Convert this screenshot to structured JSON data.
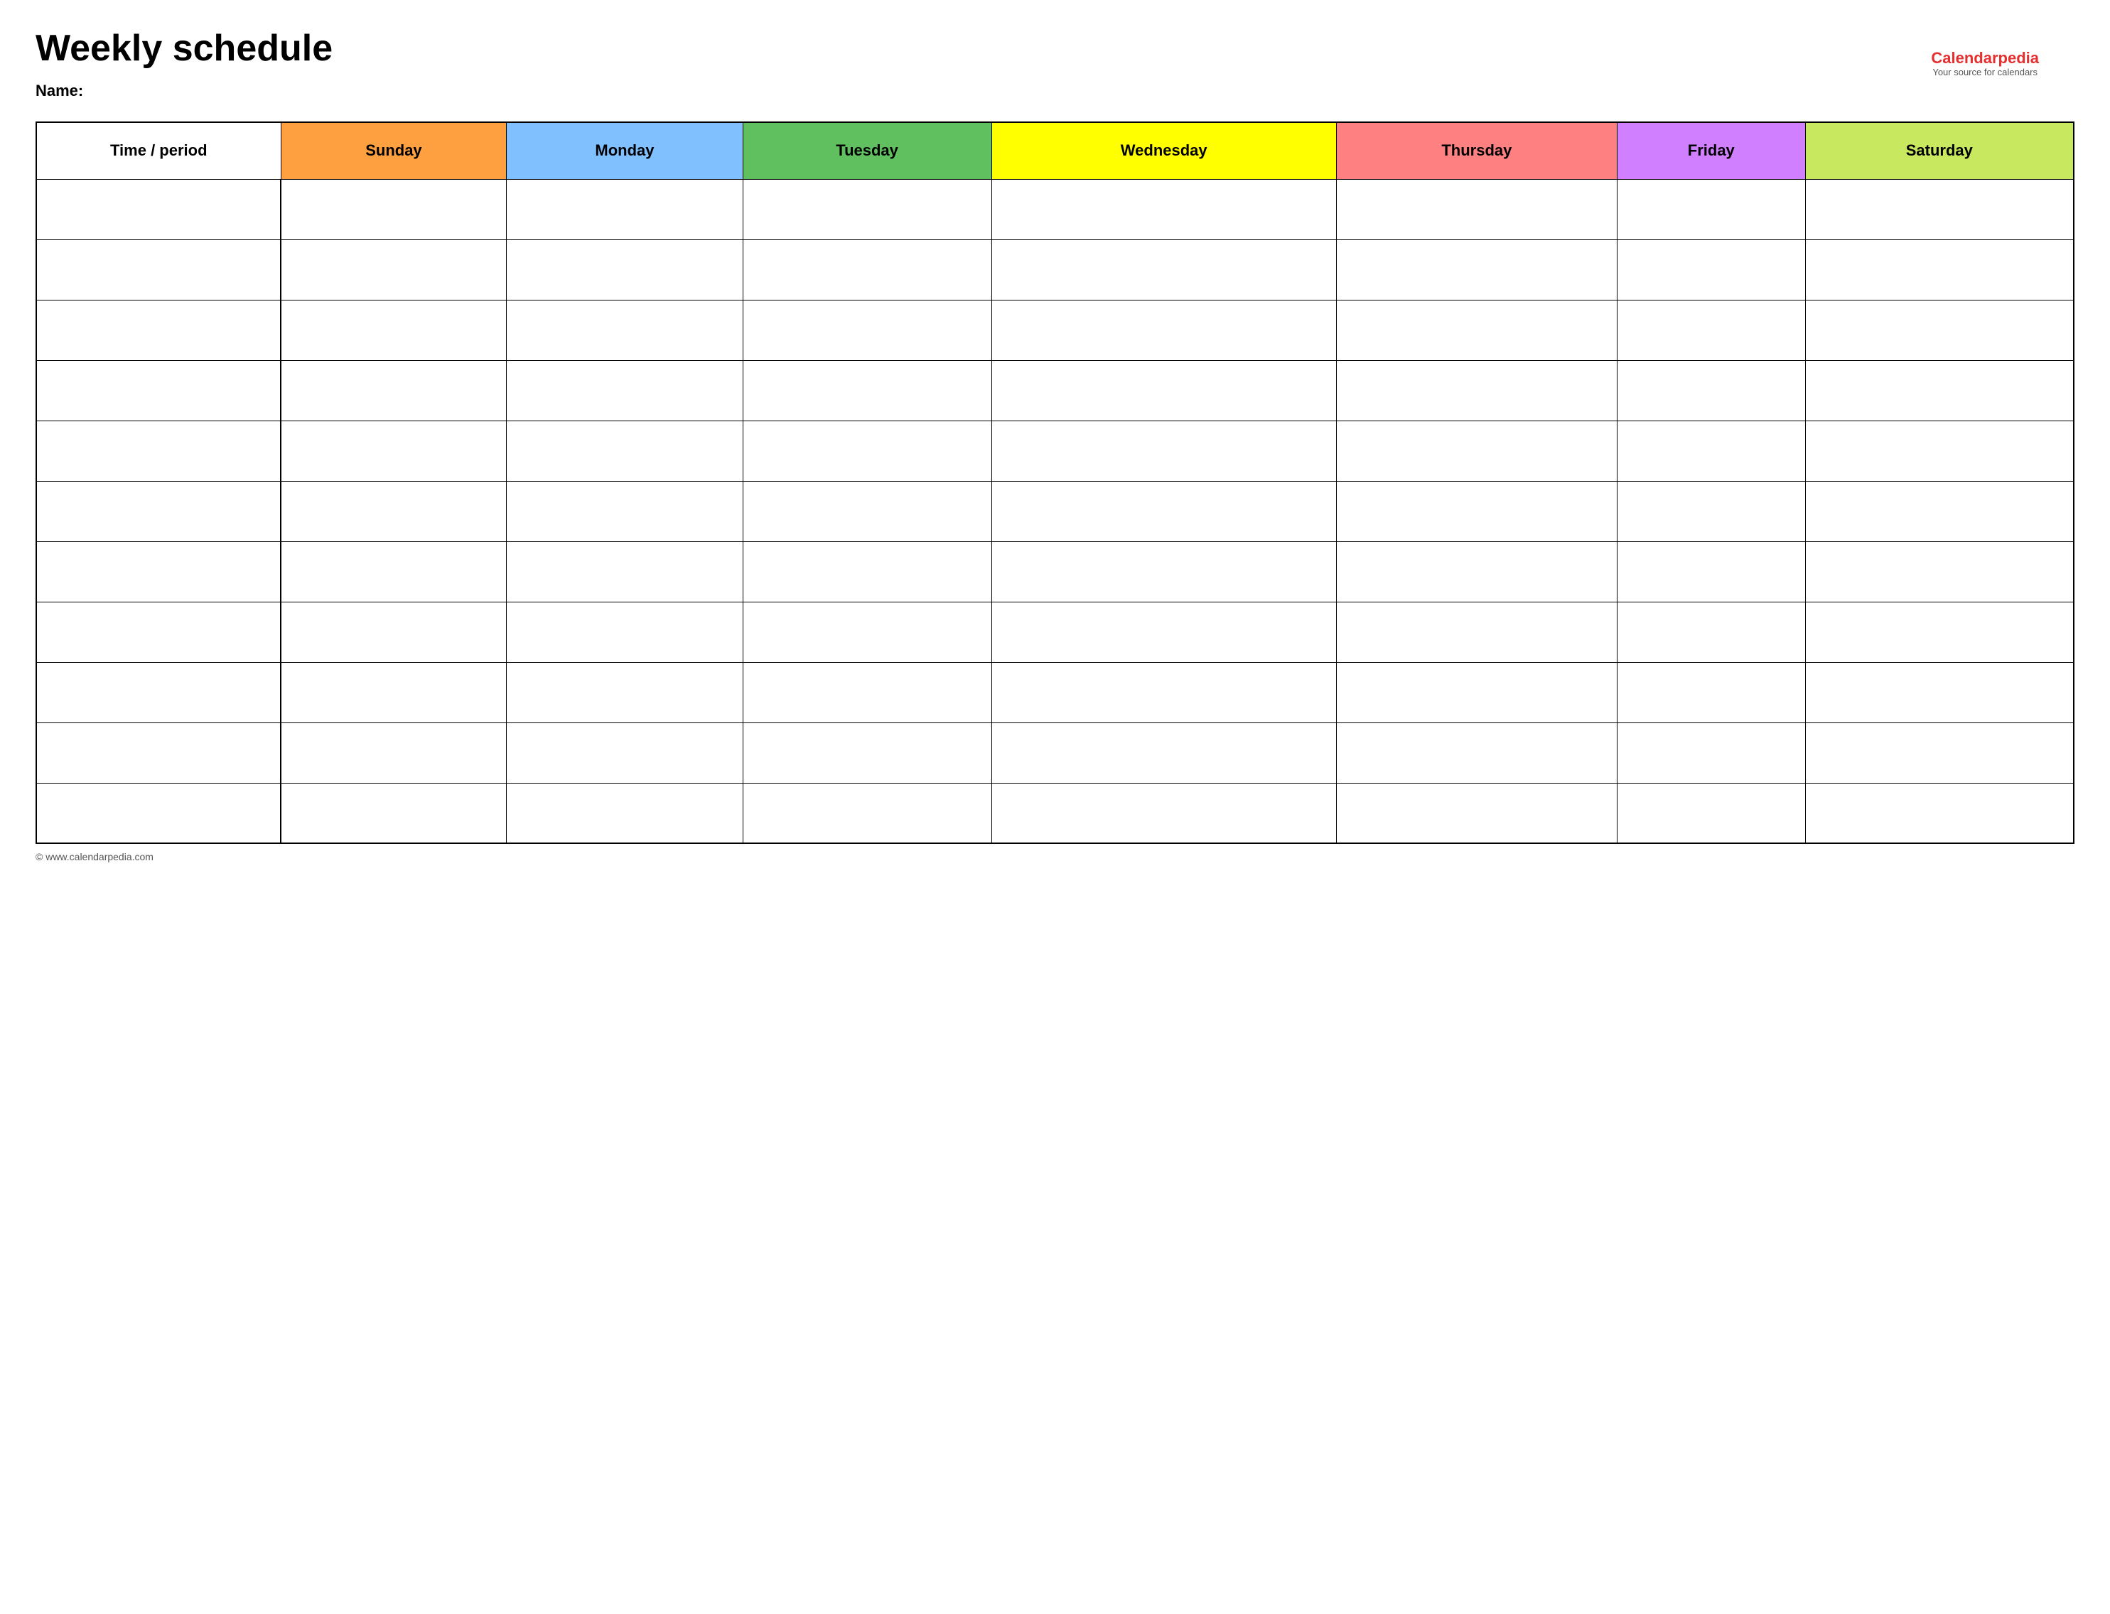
{
  "page": {
    "title": "Weekly schedule",
    "name_label": "Name:",
    "footer_text": "© www.calendarpedia.com"
  },
  "logo": {
    "brand_part1": "Calendar",
    "brand_part2": "pedia",
    "subtitle": "Your source for calendars"
  },
  "table": {
    "headers": [
      {
        "id": "time",
        "label": "Time / period",
        "class": "th-time"
      },
      {
        "id": "sunday",
        "label": "Sunday",
        "class": "th-sunday"
      },
      {
        "id": "monday",
        "label": "Monday",
        "class": "th-monday"
      },
      {
        "id": "tuesday",
        "label": "Tuesday",
        "class": "th-tuesday"
      },
      {
        "id": "wednesday",
        "label": "Wednesday",
        "class": "th-wednesday"
      },
      {
        "id": "thursday",
        "label": "Thursday",
        "class": "th-thursday"
      },
      {
        "id": "friday",
        "label": "Friday",
        "class": "th-friday"
      },
      {
        "id": "saturday",
        "label": "Saturday",
        "class": "th-saturday"
      }
    ],
    "row_count": 11
  }
}
